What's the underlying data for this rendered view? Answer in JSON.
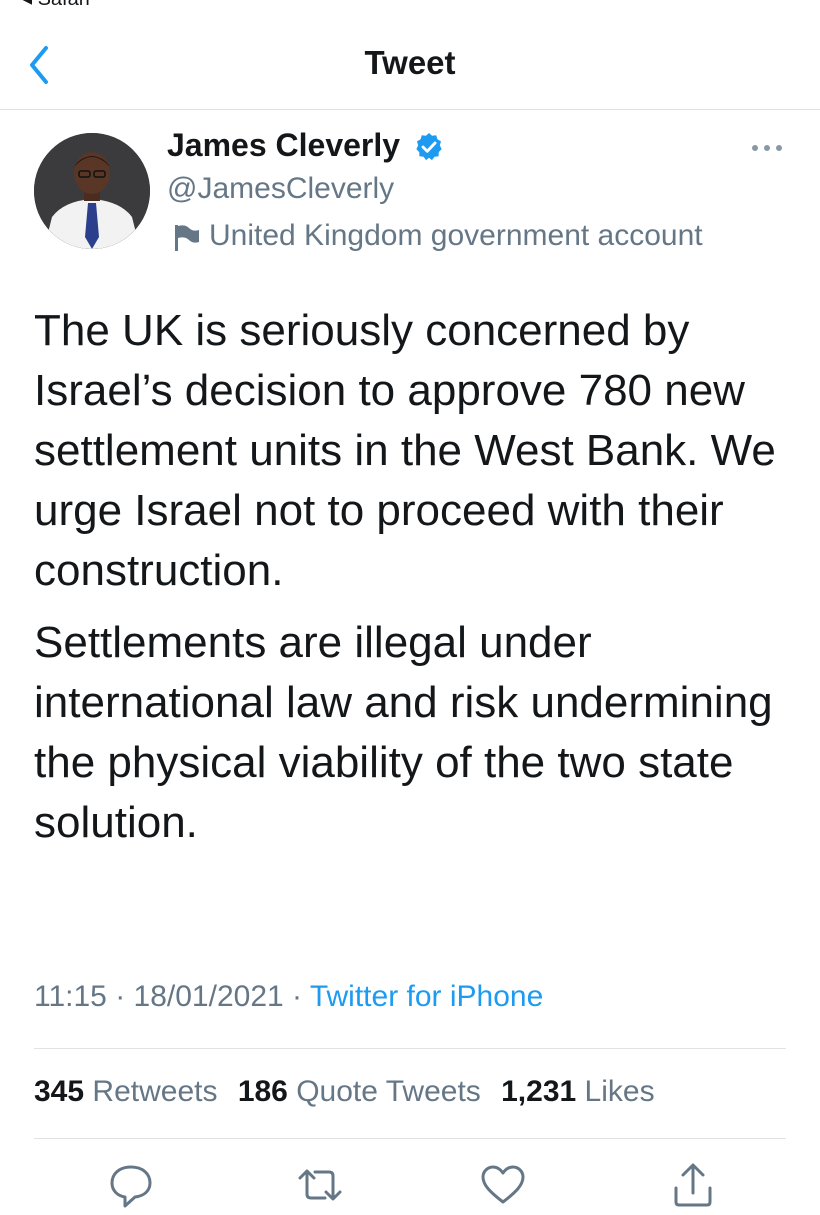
{
  "status_bar": {
    "back_app": "◂ Safari"
  },
  "nav": {
    "title": "Tweet"
  },
  "author": {
    "name": "James Cleverly",
    "handle": "@JamesCleverly",
    "label": "United Kingdom government account",
    "verified": true
  },
  "tweet": {
    "paragraphs": [
      "The UK is seriously concerned by Israel’s decision to approve 780 new settlement units in the West Bank. We urge Israel not to proceed with their construction.",
      "Settlements are illegal under international law and risk undermining the physical viability of the two state solution."
    ],
    "time": "11:15",
    "date": "18/01/2021",
    "separator": "·",
    "source": "Twitter for iPhone"
  },
  "stats": {
    "retweets_count": "345",
    "retweets_label": "Retweets",
    "quotes_count": "186",
    "quotes_label": "Quote Tweets",
    "likes_count": "1,231",
    "likes_label": "Likes"
  },
  "icons": {
    "back": "chevron-left-icon",
    "verified": "verified-badge-icon",
    "gov": "flag-icon",
    "more": "more-horizontal-icon",
    "reply": "reply-icon",
    "retweet": "retweet-icon",
    "like": "heart-icon",
    "share": "share-icon"
  },
  "colors": {
    "accent": "#1d9bf0",
    "muted": "#657786",
    "text": "#14171a",
    "divider": "#dfe3e6"
  }
}
